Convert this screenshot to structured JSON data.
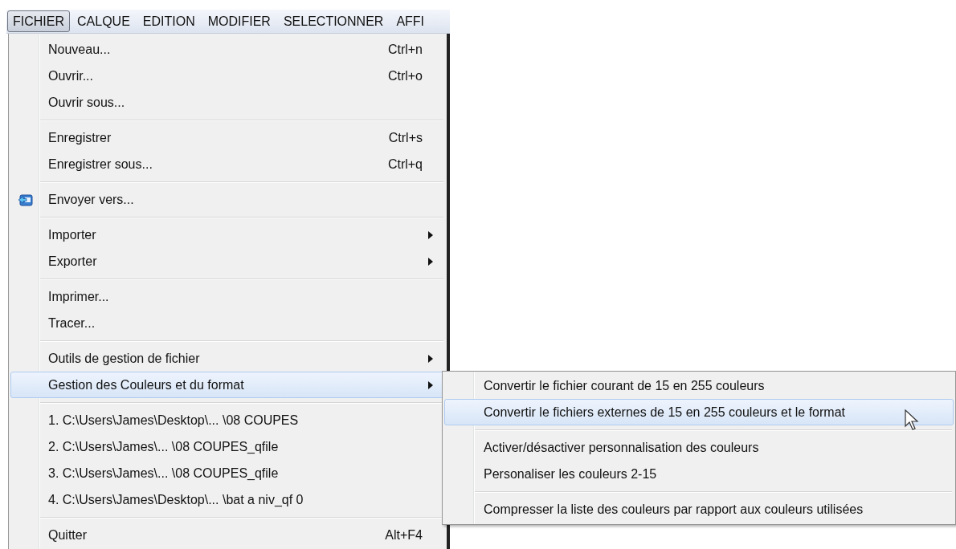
{
  "menubar": [
    {
      "label": "FICHIER",
      "selected": true
    },
    {
      "label": "CALQUE",
      "selected": false
    },
    {
      "label": "EDITION",
      "selected": false
    },
    {
      "label": "MODIFIER",
      "selected": false
    },
    {
      "label": "SELECTIONNER",
      "selected": false
    },
    {
      "label": "AFFI",
      "selected": false
    }
  ],
  "menu": [
    {
      "kind": "item",
      "label": "Nouveau...",
      "shortcut": "Ctrl+n",
      "submenu": false,
      "selected": false
    },
    {
      "kind": "item",
      "label": "Ouvrir...",
      "shortcut": "Ctrl+o",
      "submenu": false,
      "selected": false
    },
    {
      "kind": "item",
      "label": "Ouvrir sous...",
      "submenu": false,
      "selected": false
    },
    {
      "kind": "separator"
    },
    {
      "kind": "item",
      "label": "Enregistrer",
      "shortcut": "Ctrl+s",
      "submenu": false,
      "selected": false
    },
    {
      "kind": "item",
      "label": "Enregistrer sous...",
      "shortcut": "Ctrl+q",
      "submenu": false,
      "selected": false
    },
    {
      "kind": "separator"
    },
    {
      "kind": "icon-item",
      "label": "Envoyer vers...",
      "submenu": false,
      "selected": false
    },
    {
      "kind": "separator"
    },
    {
      "kind": "item",
      "label": "Importer",
      "submenu": true,
      "selected": false
    },
    {
      "kind": "item",
      "label": "Exporter",
      "submenu": true,
      "selected": false
    },
    {
      "kind": "separator"
    },
    {
      "kind": "item",
      "label": "Imprimer...",
      "submenu": false,
      "selected": false
    },
    {
      "kind": "item",
      "label": "Tracer...",
      "submenu": false,
      "selected": false
    },
    {
      "kind": "separator"
    },
    {
      "kind": "item",
      "label": "Outils de gestion de fichier",
      "submenu": true,
      "selected": false
    },
    {
      "kind": "item",
      "label": "Gestion des Couleurs et du format",
      "submenu": true,
      "selected": true
    },
    {
      "kind": "separator"
    },
    {
      "kind": "item",
      "label": "1. C:\\Users\\James\\Desktop\\... \\08 COUPES",
      "submenu": false,
      "selected": false
    },
    {
      "kind": "item",
      "label": "2. C:\\Users\\James\\... \\08 COUPES_qfile",
      "submenu": false,
      "selected": false
    },
    {
      "kind": "item",
      "label": "3. C:\\Users\\James\\... \\08 COUPES_qfile",
      "submenu": false,
      "selected": false
    },
    {
      "kind": "item",
      "label": "4. C:\\Users\\James\\Desktop\\... \\bat a niv_qf 0",
      "submenu": false,
      "selected": false
    },
    {
      "kind": "separator"
    },
    {
      "kind": "item",
      "label": "Quitter",
      "shortcut": "Alt+F4",
      "submenu": false,
      "selected": false
    }
  ],
  "submenu": [
    {
      "kind": "item",
      "label": "Convertir le fichier courant de 15 en 255 couleurs",
      "selected": false
    },
    {
      "kind": "item",
      "label": "Convertir le fichiers externes de 15 en 255 couleurs et le format",
      "selected": true
    },
    {
      "kind": "separator"
    },
    {
      "kind": "item",
      "label": "Activer/désactiver personnalisation des couleurs",
      "selected": false
    },
    {
      "kind": "item",
      "label": "Personaliser les couleurs 2-15",
      "selected": false
    },
    {
      "kind": "separator"
    },
    {
      "kind": "item",
      "label": "Compresser la liste des couleurs par rapport aux couleurs utilisées",
      "selected": false
    }
  ]
}
